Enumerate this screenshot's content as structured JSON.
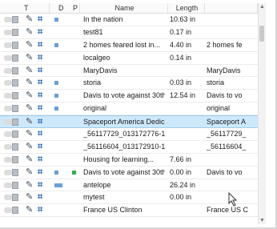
{
  "columns": {
    "type": "T",
    "d": "D",
    "p": "P",
    "name": "Name",
    "length": "Length"
  },
  "rows": [
    {
      "name": "In the nation",
      "length": "10.63 in",
      "extra": "",
      "d": true,
      "p": false,
      "selected": false
    },
    {
      "name": "test81",
      "length": "0.17 in",
      "extra": "",
      "d": false,
      "p": false,
      "selected": false
    },
    {
      "name": "2 homes feared lost in...",
      "length": "4.40 in",
      "extra": "2 homes fe",
      "d": true,
      "p": false,
      "selected": false
    },
    {
      "name": "localgeo",
      "length": "0.14 in",
      "extra": "",
      "d": false,
      "p": false,
      "selected": false
    },
    {
      "name": "MaryDavis",
      "length": "",
      "extra": "MaryDavis",
      "d": false,
      "p": false,
      "selected": false
    },
    {
      "name": "storia",
      "length": "0.03 in",
      "extra": "storia",
      "d": true,
      "p": false,
      "selected": false
    },
    {
      "name": "Davis to vote against 30th...",
      "length": "12.54 in",
      "extra": "Davis to vo",
      "d": true,
      "p": false,
      "selected": false
    },
    {
      "name": "original",
      "length": "",
      "extra": "original",
      "d": true,
      "p": false,
      "selected": false
    },
    {
      "name": "Spaceport America Dedication",
      "length": "",
      "extra": "Spaceport A",
      "d": false,
      "p": false,
      "selected": true
    },
    {
      "name": "_56117729_013172776-1",
      "length": "",
      "extra": "_56117729_",
      "d": false,
      "p": false,
      "selected": false
    },
    {
      "name": "_56116604_013172910-1",
      "length": "",
      "extra": "_56116604_",
      "d": false,
      "p": false,
      "selected": false
    },
    {
      "name": "Housing for learning...",
      "length": "7.66 in",
      "extra": "",
      "d": false,
      "p": false,
      "selected": false
    },
    {
      "name": "Davis to vote against 30th...",
      "length": "0.00 in",
      "extra": "Davis to vo",
      "d": true,
      "p": true,
      "selected": false
    },
    {
      "name": "antelope",
      "length": "26.24 in",
      "extra": "",
      "d": true,
      "p": false,
      "selected": false
    },
    {
      "name": "mytest",
      "length": "0.00 in",
      "extra": "",
      "d": false,
      "p": false,
      "selected": false
    },
    {
      "name": "France US Clinton",
      "length": "",
      "extra": "France US C",
      "d": false,
      "p": false,
      "selected": false
    }
  ],
  "colors": {
    "accent": "#6a9fd8",
    "selected": "#cde8fb",
    "green": "#2db34a"
  },
  "icons": [
    "link-icon",
    "page-icon",
    "story-icon",
    "crop-icon"
  ]
}
